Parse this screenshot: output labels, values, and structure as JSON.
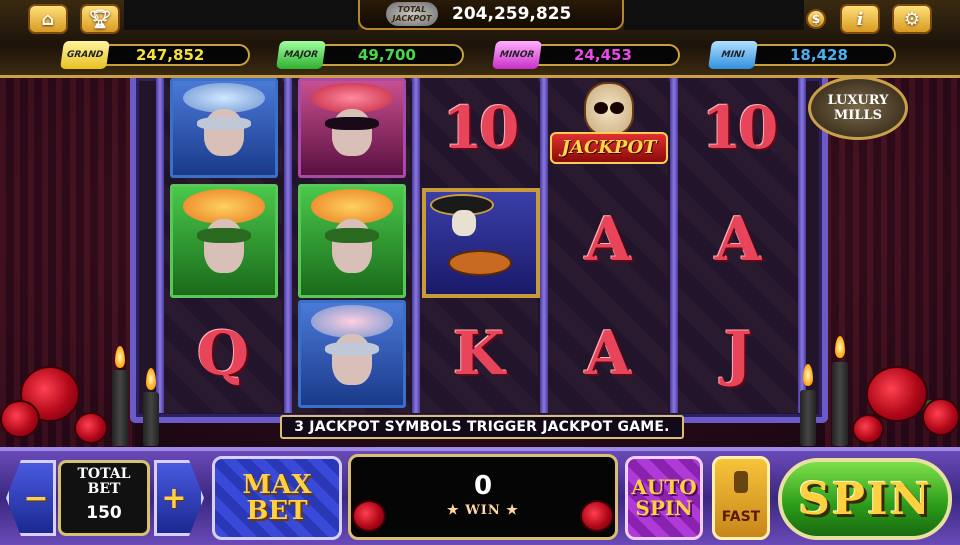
{
  "topbar": {
    "home_icon": "home-icon",
    "trophy_icon": "trophy-icon",
    "coins_icon": "coin-icon",
    "info_icon": "info-icon",
    "info_label": "i",
    "settings_icon": "gear-icon",
    "total_jackpot_label": "TOTAL JACKPOT",
    "total_jackpot_value": "204,259,825"
  },
  "jackpots": [
    {
      "label": "GRAND",
      "value": "247,852",
      "color": "#f5e03a"
    },
    {
      "label": "MAJOR",
      "value": "49,700",
      "color": "#4ad84a"
    },
    {
      "label": "MINOR",
      "value": "24,453",
      "color": "#e84ae8"
    },
    {
      "label": "MINI",
      "value": "18,428",
      "color": "#4ab0f0"
    }
  ],
  "game": {
    "logo_line1": "LUXURY",
    "logo_line2": "MILLS",
    "reels": [
      [
        "woman-blue-mask",
        "woman-green-mask",
        "Q"
      ],
      [
        "woman-red-mask",
        "woman-green-mask",
        "woman-blue-mask"
      ],
      [
        "10",
        "mariachi-skeleton",
        "K"
      ],
      [
        "JACKPOT",
        "A",
        "A"
      ],
      [
        "10",
        "A",
        "J"
      ]
    ],
    "jackpot_symbol_text": "JACKPOT",
    "message": "3 JACKPOT SYMBOLS TRIGGER JACKPOT GAME."
  },
  "controls": {
    "decrease_label": "−",
    "increase_label": "+",
    "total_bet_label_1": "TOTAL",
    "total_bet_label_2": "BET",
    "total_bet_value": "150",
    "max_bet_line1": "MAX",
    "max_bet_line2": "BET",
    "win_value": "0",
    "win_label": "★ WIN ★",
    "auto_spin_line1": "AUTO",
    "auto_spin_line2": "SPIN",
    "fast_label": "FAST",
    "spin_label": "SPIN"
  }
}
